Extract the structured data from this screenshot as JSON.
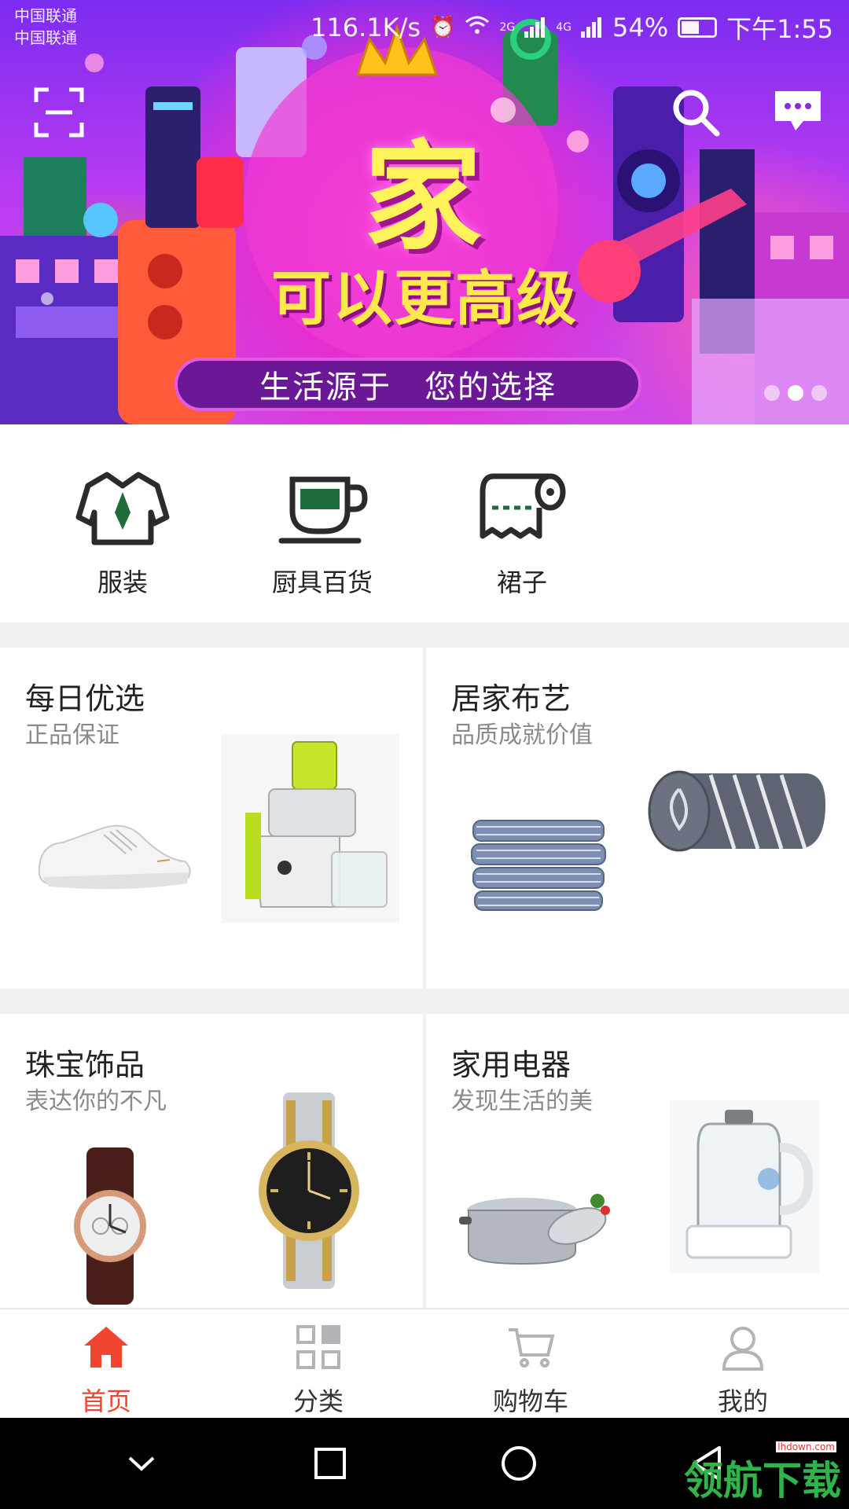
{
  "status_bar": {
    "carrier_1": "中国联通",
    "carrier_2": "中国联通",
    "speed": "116.1K/s",
    "network_1": "2G",
    "network_2": "4G",
    "battery": "54%",
    "time": "下午1:55"
  },
  "header": {
    "scan_icon": "scan-icon",
    "search_icon": "search-icon",
    "message_icon": "message-icon"
  },
  "banner": {
    "title": "家",
    "subtitle": "可以更高级",
    "slogan": "生活源于　您的选择",
    "slide_count": 3,
    "active_slide": 2
  },
  "categories": [
    {
      "label": "服装",
      "icon": "jacket-icon"
    },
    {
      "label": "厨具百货",
      "icon": "cup-icon"
    },
    {
      "label": "裙子",
      "icon": "towel-roll-icon"
    }
  ],
  "sections": [
    {
      "title": "每日优选",
      "subtitle": "正品保证",
      "products": [
        "sneaker",
        "juicer"
      ]
    },
    {
      "title": "居家布艺",
      "subtitle": "品质成就价值",
      "products": [
        "folded-towels",
        "rolled-blanket"
      ]
    },
    {
      "title": "珠宝饰品",
      "subtitle": "表达你的不凡",
      "products": [
        "leather-watch",
        "steel-watch"
      ]
    },
    {
      "title": "家用电器",
      "subtitle": "发现生活的美",
      "products": [
        "stock-pot",
        "glass-kettle"
      ]
    }
  ],
  "tabbar": [
    {
      "label": "首页",
      "icon": "home-icon",
      "active": true
    },
    {
      "label": "分类",
      "icon": "grid-icon",
      "active": false
    },
    {
      "label": "购物车",
      "icon": "cart-icon",
      "active": false
    },
    {
      "label": "我的",
      "icon": "user-icon",
      "active": false
    }
  ],
  "watermark": {
    "text": "领航下载",
    "url": "lhdown.com"
  },
  "colors": {
    "accent": "#f0462f",
    "banner_purple": "#8a2be2",
    "icon_green": "#1f6b3a"
  }
}
